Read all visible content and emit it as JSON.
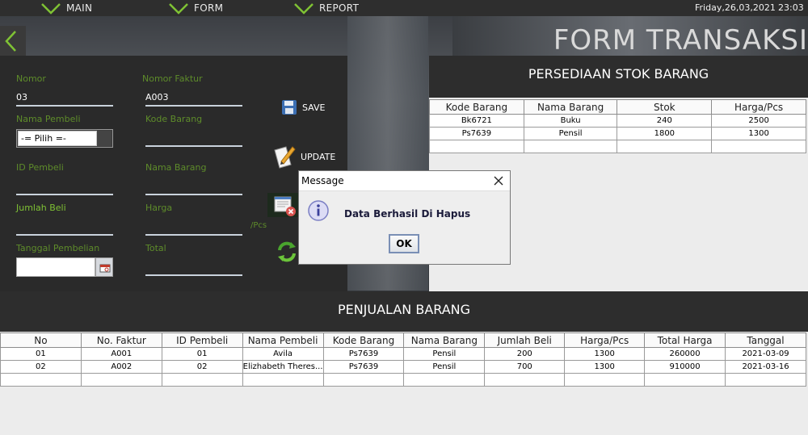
{
  "menu": {
    "items": [
      {
        "label": "MAIN"
      },
      {
        "label": "FORM"
      },
      {
        "label": "REPORT"
      }
    ]
  },
  "datetime": {
    "date": "Friday,26,03,2021",
    "time": "23:03"
  },
  "page_title": "FORM TRANSAKSI",
  "form": {
    "nomor_label": "Nomor",
    "nomor_value": "03",
    "faktur_label": "Nomor Faktur",
    "faktur_value": "A003",
    "nama_pembeli_label": "Nama Pembeli",
    "nama_pembeli_value": "-= Pilih =-",
    "kode_barang_label": "Kode Barang",
    "id_pembeli_label": "ID Pembeli",
    "nama_barang_label": "Nama Barang",
    "jumlah_beli_label": "Jumlah Beli",
    "harga_label": "Harga",
    "pcs_suffix": "/Pcs",
    "tanggal_label": "Tanggal Pembelian",
    "total_label": "Total"
  },
  "actions": {
    "save_label": "SAVE",
    "update_label": "UPDATE"
  },
  "stock": {
    "title": "PERSEDIAAN STOK BARANG",
    "columns": [
      "Kode Barang",
      "Nama Barang",
      "Stok",
      "Harga/Pcs"
    ],
    "rows": [
      [
        "Bk6721",
        "Buku",
        "240",
        "2500"
      ],
      [
        "Ps7639",
        "Pensil",
        "1800",
        "1300"
      ]
    ]
  },
  "sales": {
    "title": "PENJUALAN BARANG",
    "columns": [
      "No",
      "No. Faktur",
      "ID Pembeli",
      "Nama Pembeli",
      "Kode Barang",
      "Nama Barang",
      "Jumlah Beli",
      "Harga/Pcs",
      "Total Harga",
      "Tanggal"
    ],
    "rows": [
      [
        "01",
        "A001",
        "01",
        "Avila",
        "Ps7639",
        "Pensil",
        "200",
        "1300",
        "260000",
        "2021-03-09"
      ],
      [
        "02",
        "A002",
        "02",
        "Elizhabeth Theres...",
        "Ps7639",
        "Pensil",
        "700",
        "1300",
        "910000",
        "2021-03-16"
      ]
    ]
  },
  "dialog": {
    "title": "Message",
    "message": "Data Berhasil Di Hapus",
    "ok_label": "OK"
  }
}
